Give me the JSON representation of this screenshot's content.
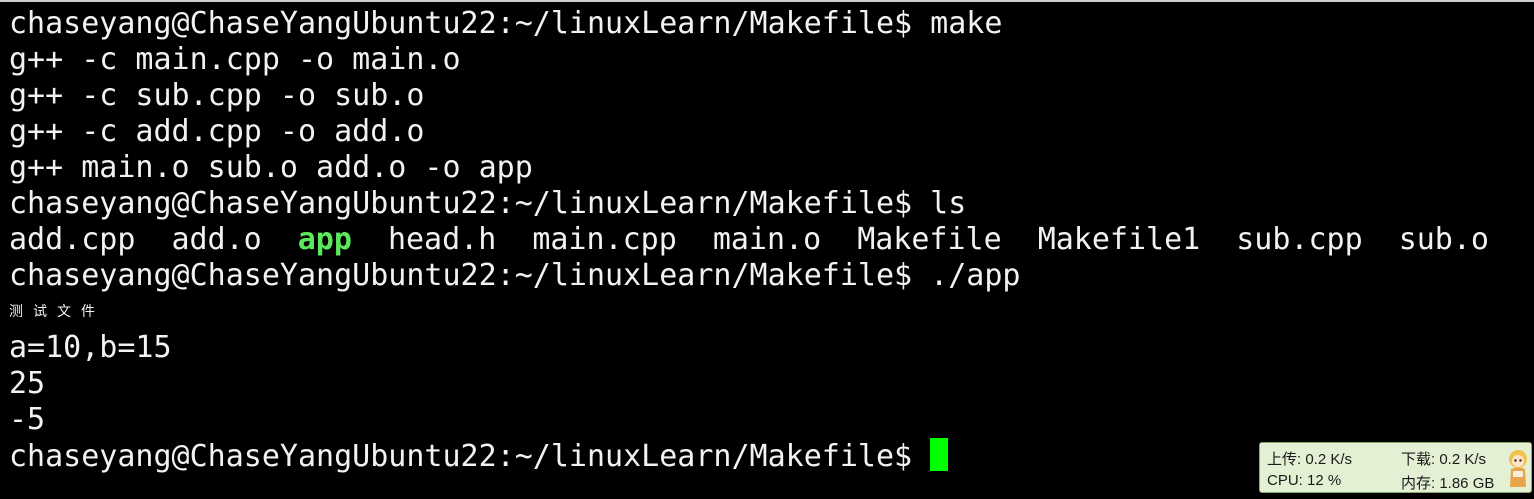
{
  "terminal": {
    "lines": [
      "chaseyang@ChaseYangUbuntu22:~/linuxLearn/Makefile$ make",
      "g++ -c main.cpp -o main.o",
      "g++ -c sub.cpp -o sub.o",
      "g++ -c add.cpp -o add.o",
      "g++ main.o sub.o add.o -o app",
      "chaseyang@ChaseYangUbuntu22:~/linuxLearn/Makefile$ ls"
    ],
    "ls_output": [
      "add.cpp",
      "add.o",
      "app",
      "head.h",
      "main.cpp",
      "main.o",
      "Makefile",
      "Makefile1",
      "sub.cpp",
      "sub.o"
    ],
    "ls_exec_color": "#5ce85c",
    "run_command": "chaseyang@ChaseYangUbuntu22:~/linuxLearn/Makefile$ ./app",
    "program_output_small": "测试文件",
    "program_output": [
      "a=10,b=15",
      "25",
      "-5"
    ],
    "prompt": "chaseyang@ChaseYangUbuntu22:~/linuxLearn/Makefile$",
    "cursor_color": "#00ff00"
  },
  "net_monitor": {
    "upload": "上传: 0.2 K/s",
    "download": "下载: 0.2 K/s",
    "cpu": "CPU: 12 %",
    "memory": "内存: 1.86 GB",
    "mascot_icon": "anime-mascot-icon"
  }
}
